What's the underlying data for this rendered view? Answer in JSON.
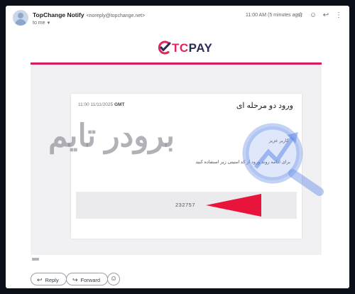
{
  "header": {
    "sender_name": "TopChange Notify",
    "sender_email": "<noreply@topchange.net>",
    "recipient": "to me",
    "time": "11:00 AM (5 minutes ago)",
    "icons": [
      "star-icon",
      "emoji-icon",
      "reply-icon",
      "more-icon"
    ]
  },
  "logo": {
    "tc": "TC",
    "pay": "PAY"
  },
  "email": {
    "date": "11:00 11/11/2025",
    "timezone": "GMT",
    "title": "ورود دو مرحله ای",
    "greeting": "کاربر عزیز",
    "body": "برای ادامه روند ورود از کد امنیتی زیر استفاده کنید",
    "code": "232757"
  },
  "watermark": {
    "text": "برودر تایم"
  },
  "actions": {
    "reply": "Reply",
    "forward": "Forward"
  },
  "colors": {
    "brand_pink": "#d81b60",
    "brand_navy": "#2b2b55",
    "arrow_red": "#e8143c"
  }
}
